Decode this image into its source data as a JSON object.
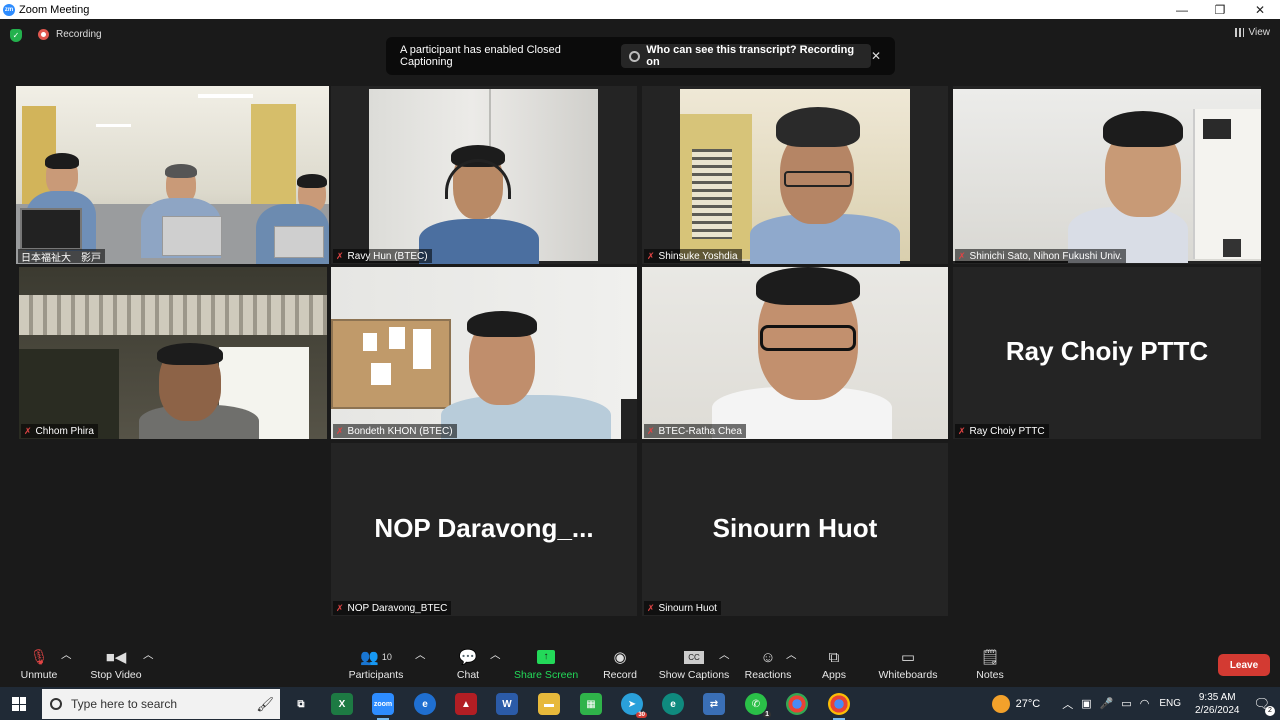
{
  "window": {
    "title": "Zoom Meeting",
    "minimize": "—",
    "maximize": "❐",
    "close": "✕"
  },
  "top": {
    "recording_label": "Recording",
    "view_label": "View",
    "cc_message": "A participant has enabled Closed Captioning",
    "cc_link": "Who can see this transcript? Recording on",
    "cc_close": "✕"
  },
  "participants": [
    {
      "name": "日本福祉大　影戸",
      "active": true
    },
    {
      "name": "Ravy Hun (BTEC)"
    },
    {
      "name": "Shinsuke Yoshdia"
    },
    {
      "name": "Shinichi Sato, Nihon Fukushi Univ."
    },
    {
      "name": "Chhom Phira"
    },
    {
      "name": "Bondeth KHON (BTEC)"
    },
    {
      "name": "BTEC-Ratha Chea"
    },
    {
      "name": "Ray Choiy PTTC",
      "display": "Ray Choiy PTTC"
    },
    {
      "name": "NOP Daravong_BTEC",
      "display": "NOP  Daravong_..."
    },
    {
      "name": "Sinourn Huot",
      "display": "Sinourn Huot"
    }
  ],
  "toolbar": {
    "unmute": "Unmute",
    "stop_video": "Stop Video",
    "participants": "Participants",
    "participants_count": "10",
    "chat": "Chat",
    "share_screen": "Share Screen",
    "record": "Record",
    "show_captions": "Show Captions",
    "reactions": "Reactions",
    "apps": "Apps",
    "whiteboards": "Whiteboards",
    "notes": "Notes",
    "leave": "Leave",
    "colors": {
      "share": "#23d959",
      "leave": "#d33a32",
      "active_border": "#e0e27a"
    }
  },
  "taskbar": {
    "search_placeholder": "Type here to search",
    "weather": "27°C",
    "language": "ENG",
    "time": "9:35 AM",
    "date": "2/26/2024",
    "notification_count": "2",
    "whatsapp_badge": "1",
    "app_badge": "30"
  }
}
